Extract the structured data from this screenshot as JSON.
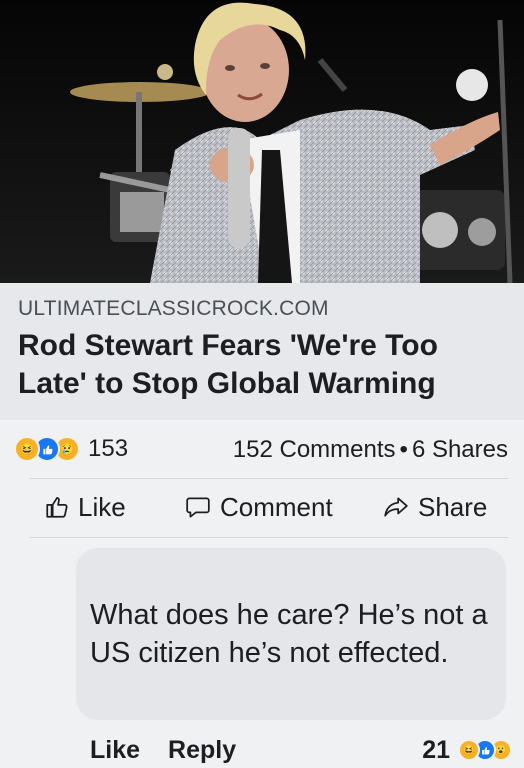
{
  "preview": {
    "domain": "ULTIMATECLASSICROCK.COM",
    "headline": "Rod Stewart Fears 'We're Too Late' to Stop Global Warming"
  },
  "stats": {
    "reaction_icons": [
      "haha-icon",
      "like-icon",
      "sad-icon"
    ],
    "reaction_count": "153",
    "comments": "152 Comments",
    "separator": "•",
    "shares": "6 Shares"
  },
  "actions": {
    "like": "Like",
    "comment": "Comment",
    "share": "Share"
  },
  "comment": {
    "text": "What does he care? He’s not a US citizen he’s not effected.",
    "like": "Like",
    "reply": "Reply",
    "reaction_count": "21",
    "reaction_icons": [
      "haha-icon",
      "like-icon",
      "wow-icon"
    ]
  },
  "colors": {
    "like_blue": "#1877f2",
    "reaction_yellow": "#f7b125",
    "background": "#f0f1f3",
    "preview_bg": "#e6e8eb"
  }
}
